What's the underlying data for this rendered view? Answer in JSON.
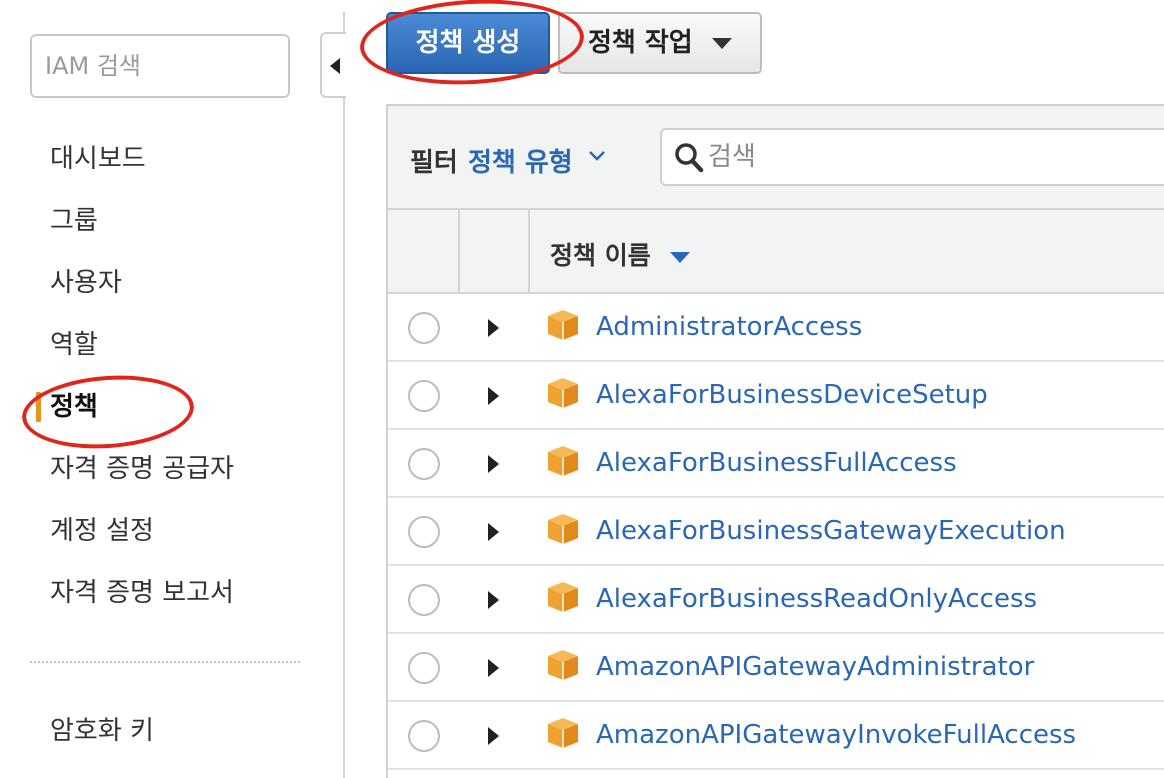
{
  "sidebar": {
    "search_placeholder": "IAM 검색",
    "items": [
      {
        "label": "대시보드",
        "active": false
      },
      {
        "label": "그룹",
        "active": false
      },
      {
        "label": "사용자",
        "active": false
      },
      {
        "label": "역할",
        "active": false
      },
      {
        "label": "정책",
        "active": true
      },
      {
        "label": "자격 증명 공급자",
        "active": false
      },
      {
        "label": "계정 설정",
        "active": false
      },
      {
        "label": "자격 증명 보고서",
        "active": false
      }
    ],
    "bottom_item": "암호화 키",
    "active_accent_color": "#e8931e"
  },
  "toolbar": {
    "create_label": "정책 생성",
    "actions_label": "정책 작업"
  },
  "filter": {
    "label": "필터",
    "type_label": "정책 유형",
    "search_placeholder": "검색"
  },
  "table": {
    "column_name": "정책 이름",
    "rows": [
      {
        "name": "AdministratorAccess"
      },
      {
        "name": "AlexaForBusinessDeviceSetup"
      },
      {
        "name": "AlexaForBusinessFullAccess"
      },
      {
        "name": "AlexaForBusinessGatewayExecution"
      },
      {
        "name": "AlexaForBusinessReadOnlyAccess"
      },
      {
        "name": "AmazonAPIGatewayAdministrator"
      },
      {
        "name": "AmazonAPIGatewayInvokeFullAccess"
      }
    ]
  },
  "colors": {
    "link": "#2a67b4",
    "primary_button": "#2a66b3",
    "policy_icon": "#f0a132",
    "annotation": "#e0261b"
  },
  "icons": {
    "collapse": "chevron-left-icon",
    "search": "search-icon",
    "policy": "policy-box-icon",
    "expand": "expand-row-icon"
  }
}
